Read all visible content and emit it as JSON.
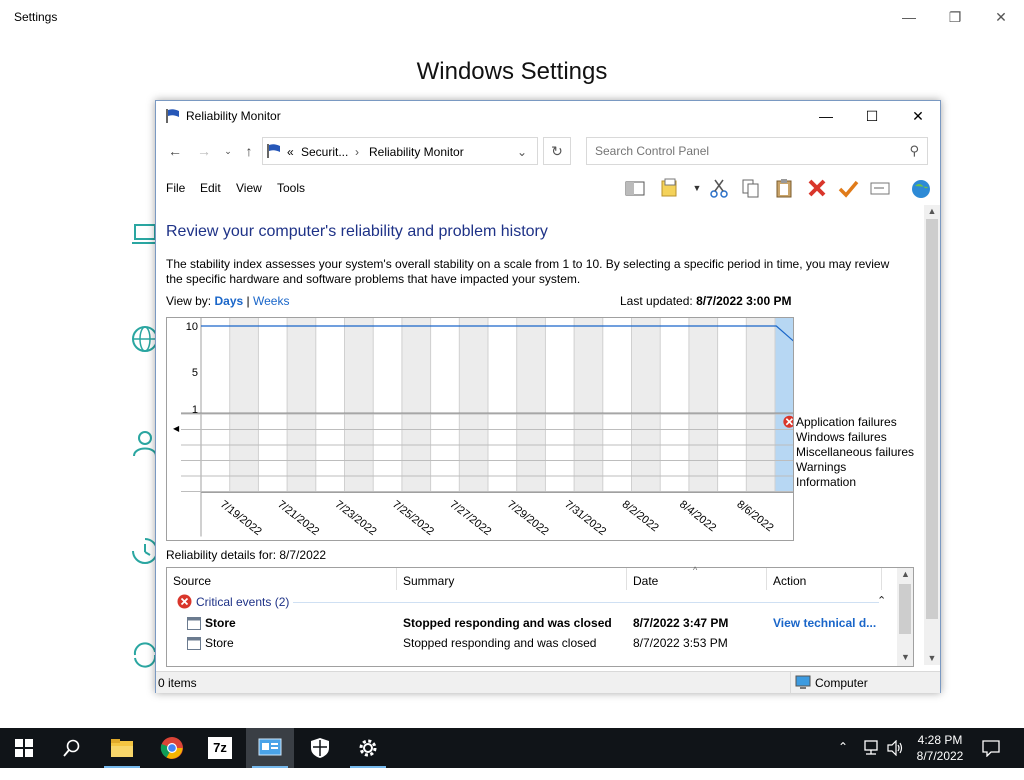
{
  "settings_window": {
    "title": "Settings",
    "heading": "Windows Settings",
    "controls": {
      "minimize": "—",
      "maximize": "❐",
      "close": "✕"
    }
  },
  "reliability_window": {
    "title": "Reliability Monitor",
    "breadcrumbs": {
      "prefix": "«",
      "parent": "Securit...",
      "current": "Reliability Monitor"
    },
    "search_placeholder": "Search Control Panel",
    "menu": [
      "File",
      "Edit",
      "View",
      "Tools"
    ],
    "heading": "Review your computer's reliability and problem history",
    "description": "The stability index assesses your system's overall stability on a scale from 1 to 10. By selecting a specific period in time, you may review the specific hardware and software problems that have impacted your system.",
    "view_by_label": "View by:",
    "view_days": "Days",
    "view_sep": "|",
    "view_weeks": "Weeks",
    "last_updated_label": "Last updated:",
    "last_updated_value": "8/7/2022 3:00 PM",
    "legend": [
      "Application failures",
      "Windows failures",
      "Miscellaneous failures",
      "Warnings",
      "Information"
    ],
    "details_label": "Reliability details for: 8/7/2022",
    "table": {
      "columns": [
        "Source",
        "Summary",
        "Date",
        "Action"
      ],
      "group": "Critical events (2)",
      "rows": [
        {
          "source": "Store",
          "summary": "Stopped responding and was closed",
          "date": "8/7/2022 3:47 PM",
          "action": "View technical d...",
          "bold": true
        },
        {
          "source": "Store",
          "summary": "Stopped responding and was closed",
          "date": "8/7/2022 3:53 PM",
          "action": "",
          "bold": false
        }
      ]
    },
    "status": {
      "items": "0 items",
      "zone": "Computer"
    }
  },
  "chart_data": {
    "type": "line",
    "title": "",
    "xlabel": "",
    "ylabel": "",
    "ylim": [
      1,
      10
    ],
    "y_ticks": [
      "10",
      "5",
      "1"
    ],
    "x_tick_labels": [
      "7/19/2022",
      "7/21/2022",
      "7/23/2022",
      "7/25/2022",
      "7/27/2022",
      "7/29/2022",
      "7/31/2022",
      "8/2/2022",
      "8/4/2022",
      "8/6/2022"
    ],
    "columns": [
      "7/18/2022",
      "7/19/2022",
      "7/20/2022",
      "7/21/2022",
      "7/22/2022",
      "7/23/2022",
      "7/24/2022",
      "7/25/2022",
      "7/26/2022",
      "7/27/2022",
      "7/28/2022",
      "7/29/2022",
      "7/30/2022",
      "7/31/2022",
      "8/1/2022",
      "8/2/2022",
      "8/3/2022",
      "8/4/2022",
      "8/5/2022",
      "8/6/2022",
      "8/7/2022"
    ],
    "stability_index": [
      10,
      10,
      10,
      10,
      10,
      10,
      10,
      10,
      10,
      10,
      10,
      10,
      10,
      10,
      10,
      10,
      10,
      10,
      10,
      10,
      10,
      10,
      7.4
    ],
    "selected_column": "8/7/2022",
    "event_rows": [
      "Application failures",
      "Windows failures",
      "Miscellaneous failures",
      "Warnings",
      "Information"
    ],
    "events": [
      {
        "row": "Application failures",
        "date": "8/7/2022",
        "kind": "critical"
      }
    ],
    "colors": {
      "line": "#1a66c9",
      "selected": "#b7d7f3",
      "shaded": "#ececec",
      "critical": "#d9362b"
    }
  },
  "taskbar": {
    "apps": [
      "start-icon",
      "search-icon",
      "file-explorer-icon",
      "chrome-icon",
      "7zip-icon",
      "control-panel-icon",
      "security-icon",
      "settings-icon"
    ],
    "seven_zip_label": "7z",
    "time": "4:28 PM",
    "date": "8/7/2022"
  }
}
